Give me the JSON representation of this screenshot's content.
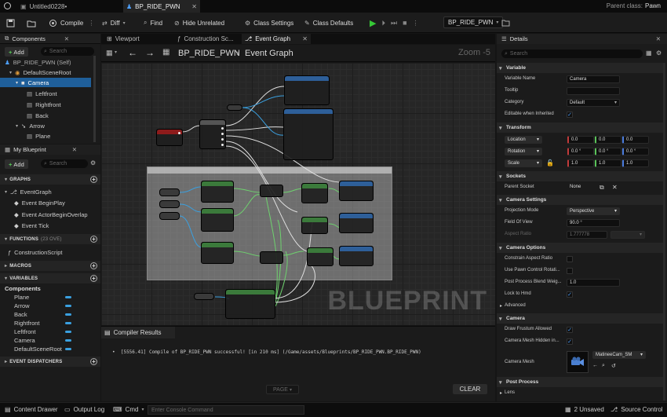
{
  "tabs": {
    "untitled": "Untitled0228•",
    "blueprint": "BP_RIDE_PWN",
    "parent_label": "Parent class:",
    "parent_value": "Pawn"
  },
  "toolbar": {
    "compile": "Compile",
    "diff": "Diff",
    "find": "Find",
    "hide_unrelated": "Hide Unrelated",
    "class_settings": "Class Settings",
    "class_defaults": "Class Defaults",
    "debug_object": "BP_RIDE_PWN"
  },
  "components": {
    "title": "Components",
    "add": "Add",
    "search_placeholder": "Search",
    "self": "BP_RIDE_PWN (Self)",
    "tree": [
      "DefaultSceneRoot",
      "Camera",
      "Leftfront",
      "Rightfront",
      "Back",
      "Arrow",
      "Plane"
    ]
  },
  "my_blueprint": {
    "title": "My Blueprint",
    "add": "Add",
    "search_placeholder": "Search",
    "graphs_header": "GRAPHS",
    "event_graph": "EventGraph",
    "events": [
      "Event BeginPlay",
      "Event ActorBeginOverlap",
      "Event Tick"
    ],
    "functions_header": "FUNCTIONS",
    "functions_count": "(23 OVE)",
    "construction_script": "ConstructionScript",
    "macros_header": "MACROS",
    "variables_header": "VARIABLES",
    "components_group": "Components",
    "variables": [
      "Plane",
      "Arrow",
      "Back",
      "Rightfront",
      "Leftfront",
      "Camera",
      "DefaultSceneRoot"
    ],
    "dispatchers_header": "EVENT DISPATCHERS"
  },
  "graph_tabs": [
    "Viewport",
    "Construction Sc...",
    "Event Graph"
  ],
  "graph": {
    "breadcrumb_root": "BP_RIDE_PWN",
    "breadcrumb_separator": "›",
    "breadcrumb_current": "Event Graph",
    "zoom": "Zoom -5",
    "watermark": "BLUEPRINT",
    "page_button": "PAGE",
    "clear_button": "CLEAR"
  },
  "compiler": {
    "title": "Compiler Results",
    "message": "[5556.41] Compile of BP_RIDE_PWN successful! [in 210 ms] (/Game/assets/Blueprints/BP_RIDE_PWN.BP_RIDE_PWN)"
  },
  "details": {
    "title": "Details",
    "search_placeholder": "Search",
    "sections": {
      "variable": "Variable",
      "transform": "Transform",
      "sockets": "Sockets",
      "camera_settings": "Camera Settings",
      "camera_options": "Camera Options",
      "camera": "Camera",
      "post_process": "Post Process"
    },
    "variable": {
      "name_label": "Variable Name",
      "name_value": "Camera",
      "tooltip_label": "Tooltip",
      "category_label": "Category",
      "category_value": "Default",
      "editable_label": "Editable when Inherited"
    },
    "transform": {
      "location_label": "Location",
      "location": [
        "0.0",
        "0.0",
        "0.0"
      ],
      "rotation_label": "Rotation",
      "rotation": [
        "0.0 °",
        "0.0 °",
        "0.0 °"
      ],
      "scale_label": "Scale",
      "scale": [
        "1.0",
        "1.0",
        "1.0"
      ]
    },
    "sockets": {
      "parent_socket_label": "Parent Socket",
      "parent_socket_value": "None"
    },
    "camera_settings": {
      "projection_label": "Projection Mode",
      "projection_value": "Perspective",
      "fov_label": "Field Of View",
      "fov_value": "90.0 °",
      "aspect_label": "Aspect Ratio",
      "aspect_value": "1.777778"
    },
    "camera_options": {
      "constrain_label": "Constrain Aspect Ratio",
      "pawn_control_label": "Use Pawn Control Rotati...",
      "blend_label": "Post Process Blend Weig...",
      "blend_value": "1.0",
      "lock_label": "Lock to Hmd",
      "advanced": "Advanced"
    },
    "camera": {
      "frustum_label": "Draw Frustum Allowed",
      "hidden_label": "Camera Mesh Hidden in...",
      "mesh_label": "Camera Mesh",
      "mesh_value": "MatineeCam_SM"
    },
    "post_process": {
      "lens": "Lens"
    }
  },
  "status": {
    "content_drawer": "Content Drawer",
    "output_log": "Output Log",
    "cmd": "Cmd",
    "console_placeholder": "Enter Console Command",
    "unsaved": "2 Unsaved",
    "source_control": "Source Control"
  }
}
